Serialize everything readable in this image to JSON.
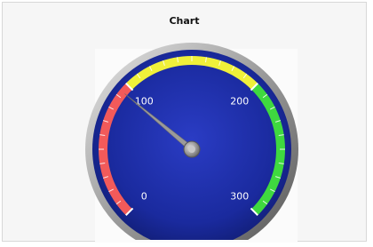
{
  "chart_data": {
    "type": "gauge",
    "title": "Chart",
    "min": 0,
    "max": 300,
    "value": 94,
    "tick_labels": [
      "0",
      "100",
      "200",
      "300"
    ],
    "bands": [
      {
        "from": 0,
        "to": 100,
        "color": "#f25a5a"
      },
      {
        "from": 100,
        "to": 200,
        "color": "#f0f03a"
      },
      {
        "from": 200,
        "to": 300,
        "color": "#3fd93f"
      }
    ],
    "dial_color": "#1a2a9e",
    "needle_color": "#9a9a9a"
  }
}
